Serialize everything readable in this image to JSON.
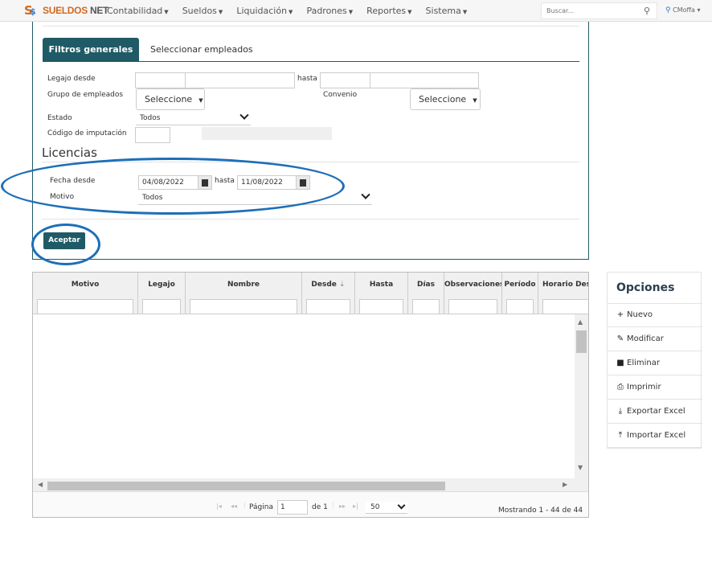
{
  "brand": {
    "name_a": "SUELDOS",
    "name_b": " NET"
  },
  "nav": [
    "Contabilidad",
    "Sueldos",
    "Liquidación",
    "Padrones",
    "Reportes",
    "Sistema"
  ],
  "search": {
    "placeholder": "Buscar..."
  },
  "user": {
    "name": "CMoffa"
  },
  "tabs": {
    "active": "Filtros generales",
    "inactive": "Seleccionar empleados"
  },
  "filters": {
    "legajo_label": "Legajo desde",
    "hasta_label": "hasta",
    "grupo_label": "Grupo de empleados",
    "grupo_value": "Seleccione",
    "convenio_label": "Convenio",
    "convenio_value": "Seleccione",
    "estado_label": "Estado",
    "estado_value": "Todos",
    "codigo_label": "Código de imputación"
  },
  "licencias": {
    "title": "Licencias",
    "fecha_label": "Fecha desde",
    "fecha_desde": "04/08/2022",
    "hasta_label": "hasta",
    "fecha_hasta": "11/08/2022",
    "motivo_label": "Motivo",
    "motivo_value": "Todos"
  },
  "aceptar_label": "Aceptar",
  "grid": {
    "columns": [
      "Motivo",
      "Legajo",
      "Nombre",
      "Desde",
      "Hasta",
      "Días",
      "Observaciones",
      "Período",
      "Horario Desde"
    ],
    "sort_indicator": "⇣"
  },
  "pager": {
    "page_label": "Página",
    "page_value": "1",
    "of_label": "de 1",
    "rows_value": "50",
    "summary": "Mostrando 1 - 44 de 44"
  },
  "options": {
    "title": "Opciones",
    "items": [
      "Nuevo",
      "Modificar",
      "Eliminar",
      "Imprimir",
      "Exportar Excel",
      "Importar Excel"
    ],
    "icons": [
      "plus-icon",
      "pencil-icon",
      "trash-icon",
      "printer-icon",
      "download-icon",
      "upload-icon"
    ]
  },
  "colors": {
    "accent": "#1f5a66",
    "annotation": "#1d6fb8",
    "brand_orange": "#d2691e"
  }
}
